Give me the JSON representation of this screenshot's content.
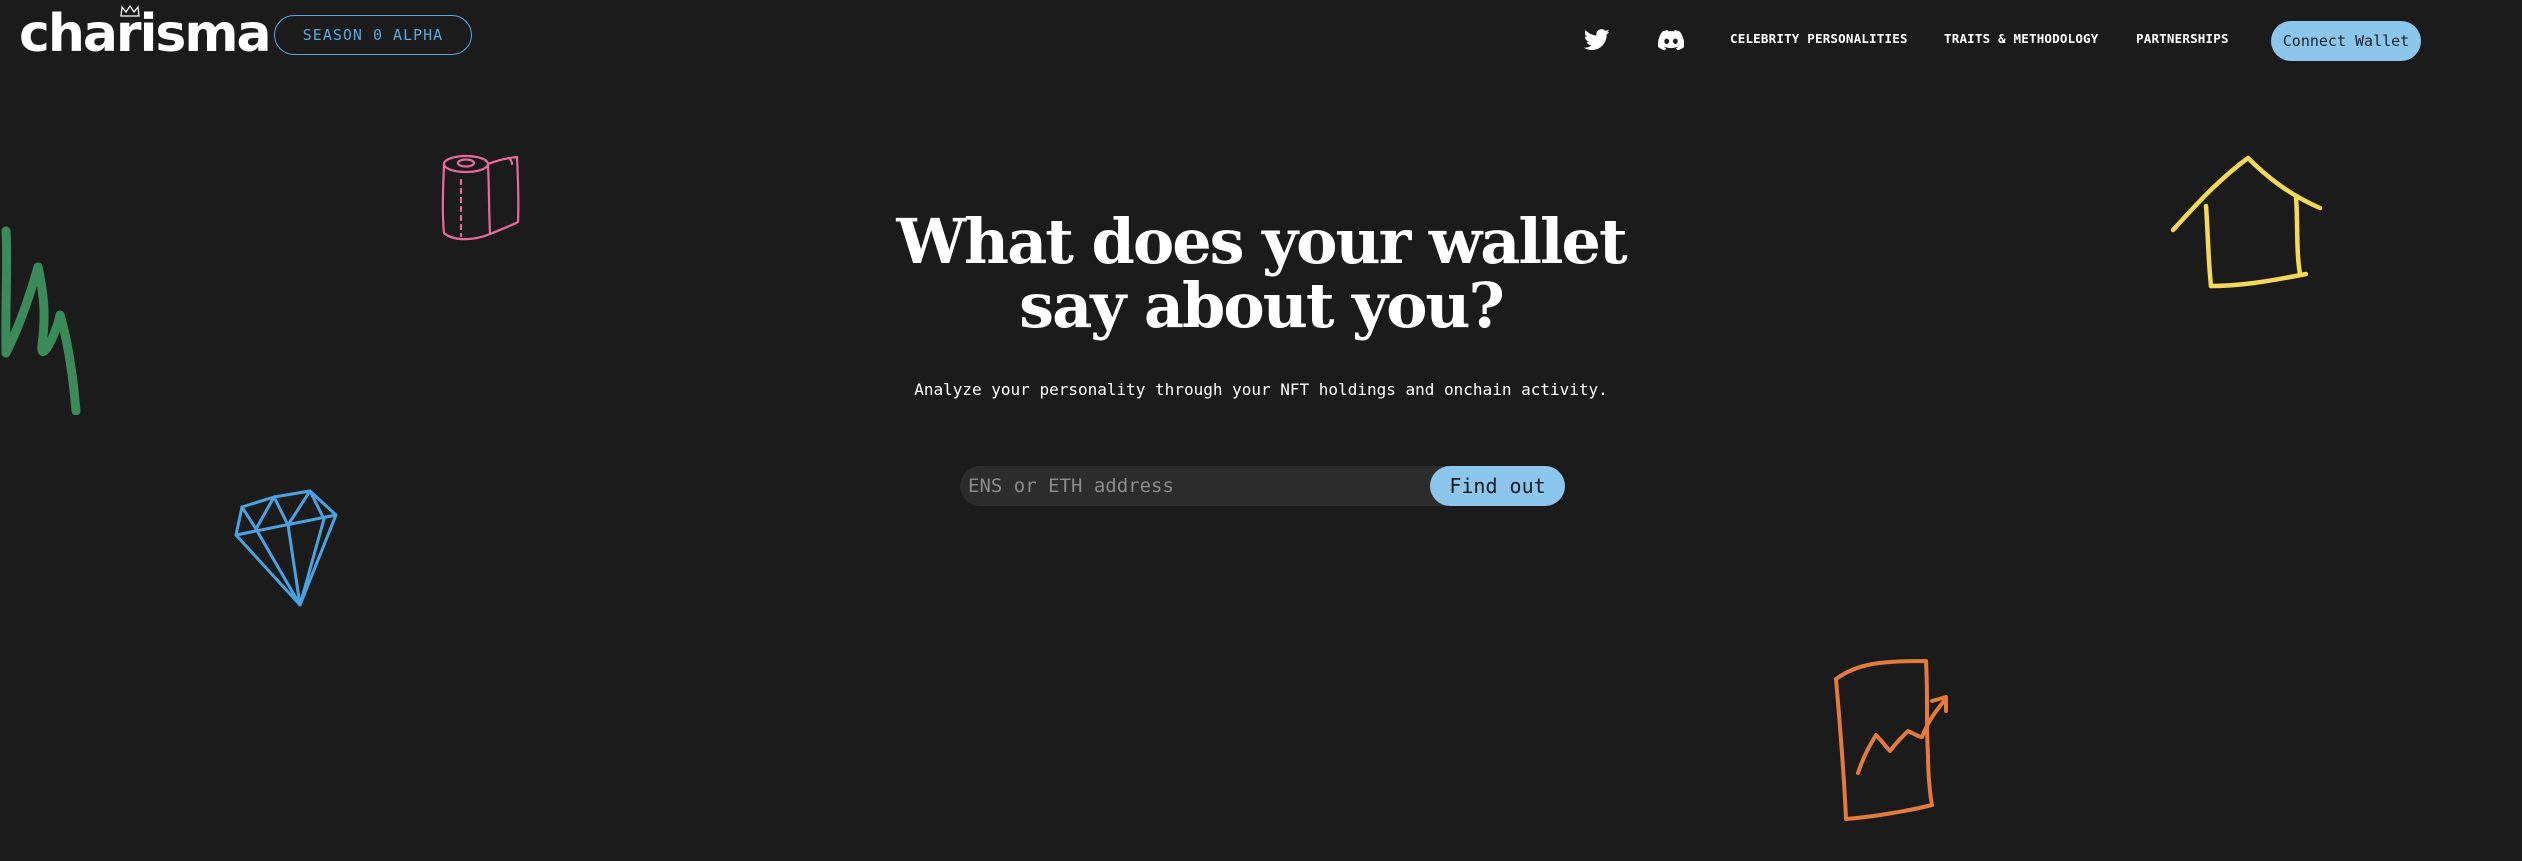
{
  "header": {
    "logo_text": "charisma",
    "season_badge": "SEASON 0 ALPHA",
    "twitter_icon": "twitter-icon",
    "discord_icon": "discord-icon",
    "nav_links": [
      "CELEBRITY PERSONALITIES",
      "TRAITS & METHODOLOGY",
      "PARTNERSHIPS"
    ],
    "connect_wallet": "Connect Wallet"
  },
  "hero": {
    "title_line1": "What does your wallet",
    "title_line2": "say about you?",
    "subtitle": "Analyze your personality through your NFT holdings and onchain activity.",
    "search_placeholder": "ENS or ETH address",
    "search_value": "",
    "find_out": "Find out"
  },
  "colors": {
    "background": "#1b1b1b",
    "accent_blue": "#8cc6ec",
    "badge_blue": "#5aa7dc",
    "doodle_pink": "#e86a9a",
    "doodle_green": "#3b8a5a",
    "doodle_blue": "#4aa3e0",
    "doodle_yellow": "#f3d85a",
    "doodle_orange": "#e47a3c"
  },
  "decorations": [
    "toilet-paper-doodle",
    "squiggle-doodle",
    "diamond-doodle",
    "house-doodle",
    "chart-doodle"
  ]
}
